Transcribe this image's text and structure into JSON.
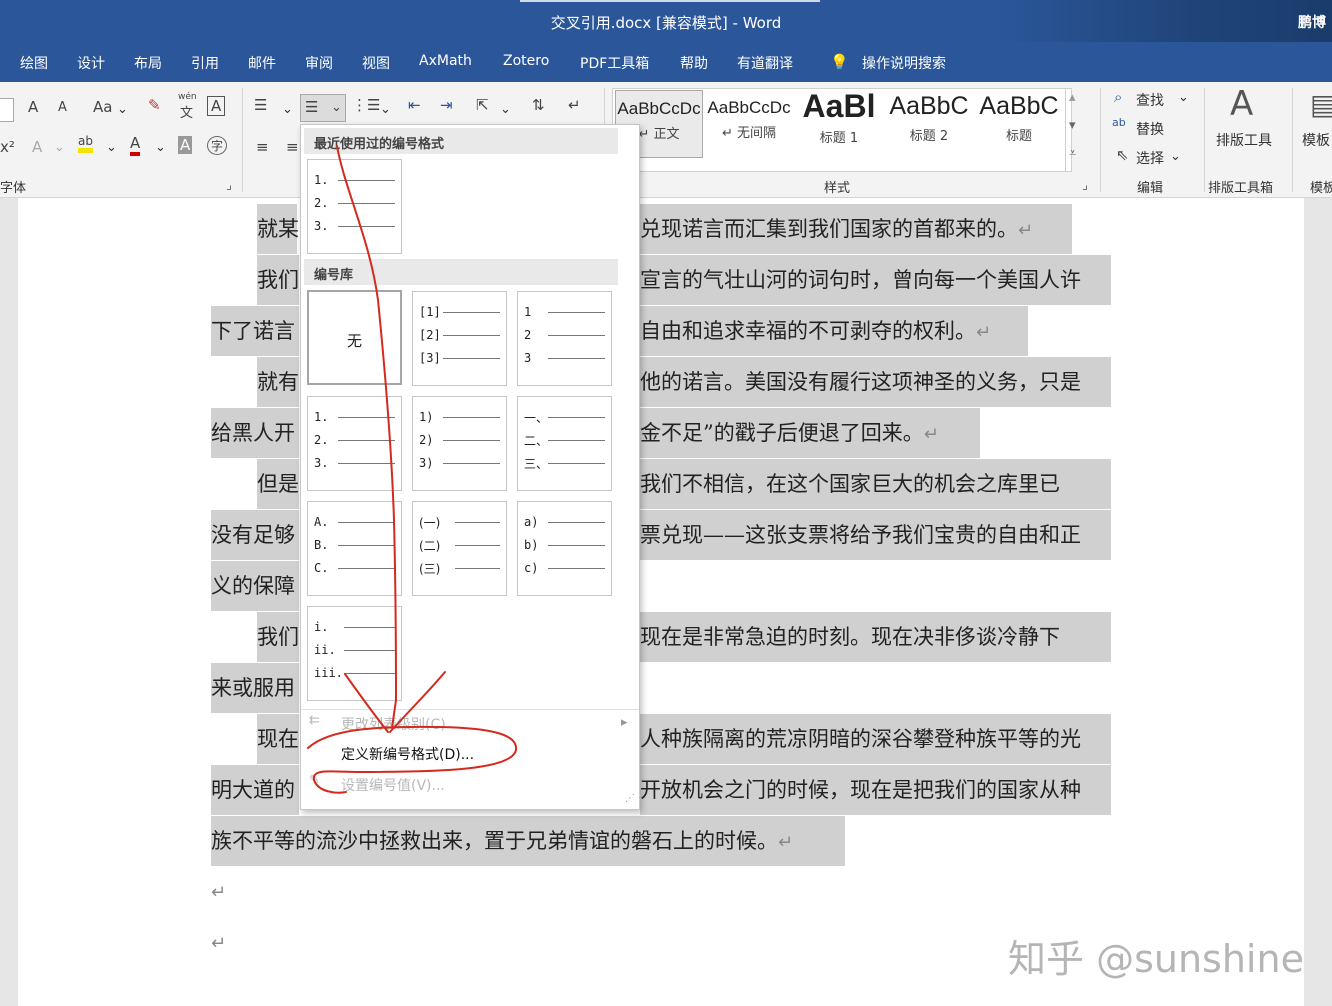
{
  "window": {
    "title": "交叉引用.docx [兼容模式]  -  Word",
    "user": "鹏博"
  },
  "menu_tabs": [
    "绘图",
    "设计",
    "布局",
    "引用",
    "邮件",
    "审阅",
    "视图",
    "AxMath",
    "Zotero",
    "PDF工具箱",
    "帮助",
    "有道翻译"
  ],
  "tell_me": "操作说明搜索",
  "ribbon": {
    "font_group_label": "字体",
    "styles_group_label": "样式",
    "editing_group_label": "编辑",
    "typeset_group_label": "排版工具箱",
    "template_group_label": "模板",
    "styles": [
      {
        "preview": "AaBbCcDc",
        "name": "↵ 正文"
      },
      {
        "preview": "AaBbCcDc",
        "name": "↵ 无间隔"
      },
      {
        "preview": "AaBl",
        "name": "标题 1"
      },
      {
        "preview": "AaBbC",
        "name": "标题 2"
      },
      {
        "preview": "AaBbC",
        "name": "标题"
      }
    ],
    "find": "查找",
    "replace": "替换",
    "select": "选择",
    "typeset_tool": "排版工具",
    "template": "模板",
    "font_buttons": {
      "grow": "A",
      "shrink": "A",
      "case": "Aa",
      "pinyin_top": "wén",
      "pinyin_bottom": "文",
      "border": "A",
      "superscript": "x²",
      "effects": "A",
      "highlight": "ab",
      "color": "A",
      "shade": "A",
      "enclose": "字"
    }
  },
  "dropdown": {
    "recent_header": "最近使用过的编号格式",
    "library_header": "编号库",
    "none_label": "无",
    "recent": [
      "1.",
      "2.",
      "3."
    ],
    "library": [
      [
        "[1]",
        "[2]",
        "[3]"
      ],
      [
        "1",
        "2",
        "3"
      ],
      [
        "1.",
        "2.",
        "3."
      ],
      [
        "1)",
        "2)",
        "3)"
      ],
      [
        "一、",
        "二、",
        "三、"
      ],
      [
        "A.",
        "B.",
        "C."
      ],
      [
        "(一)",
        "(二)",
        "(三)"
      ],
      [
        "a)",
        "b)",
        "c)"
      ],
      [
        "i.",
        "ii.",
        "iii."
      ]
    ],
    "change_level": "更改列表级别(C)",
    "define_new": "定义新编号格式(D)...",
    "set_value": "设置编号值(V)..."
  },
  "document": {
    "lines": [
      {
        "left": "就某",
        "right": "兑现诺言而汇集到我们国家的首都来的。"
      },
      {
        "left": "我们",
        "right": "宣言的气壮山河的词句时，曾向每一个美国人许"
      },
      {
        "left": "下了诺言",
        "right": "自由和追求幸福的不可剥夺的权利。"
      },
      {
        "left": "就有",
        "right": "他的诺言。美国没有履行这项神圣的义务，只是"
      },
      {
        "left": "给黑人开",
        "right": "金不足”的戳子后便退了回来。"
      },
      {
        "left": "但是",
        "right": "我们不相信，在这个国家巨大的机会之库里已"
      },
      {
        "left": "没有足够",
        "right": "票兑现——这张支票将给予我们宝贵的自由和正"
      },
      {
        "left": "义的保障",
        "right": ""
      },
      {
        "left": "我们",
        "right": "现在是非常急迫的时刻。现在决非侈谈冷静下"
      },
      {
        "left": "来或服用",
        "right": ""
      },
      {
        "left": "现在",
        "right": "人种族隔离的荒凉阴暗的深谷攀登种族平等的光"
      },
      {
        "left": "明大道的",
        "right": "开放机会之门的时候，现在是把我们的国家从种"
      },
      {
        "left": "族不平等的流沙中拯救出来，置于兄弟情谊的磐石上的时候。",
        "right": ""
      }
    ],
    "paragraph_mark": "↵"
  },
  "watermark": "知乎 @sunshine"
}
